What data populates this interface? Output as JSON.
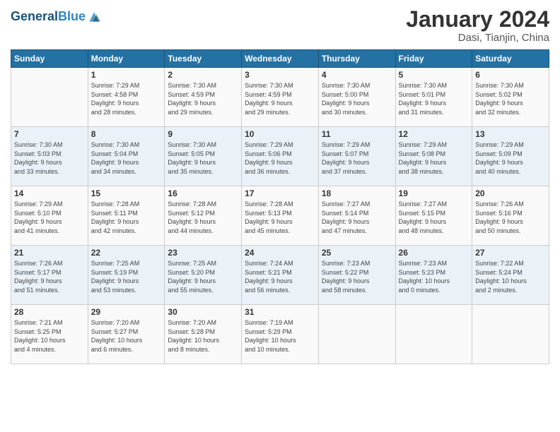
{
  "header": {
    "logo_line1": "General",
    "logo_line2": "Blue",
    "month": "January 2024",
    "location": "Dasi, Tianjin, China"
  },
  "columns": [
    "Sunday",
    "Monday",
    "Tuesday",
    "Wednesday",
    "Thursday",
    "Friday",
    "Saturday"
  ],
  "weeks": [
    [
      {
        "day": "",
        "info": ""
      },
      {
        "day": "1",
        "info": "Sunrise: 7:29 AM\nSunset: 4:58 PM\nDaylight: 9 hours\nand 28 minutes."
      },
      {
        "day": "2",
        "info": "Sunrise: 7:30 AM\nSunset: 4:59 PM\nDaylight: 9 hours\nand 29 minutes."
      },
      {
        "day": "3",
        "info": "Sunrise: 7:30 AM\nSunset: 4:59 PM\nDaylight: 9 hours\nand 29 minutes."
      },
      {
        "day": "4",
        "info": "Sunrise: 7:30 AM\nSunset: 5:00 PM\nDaylight: 9 hours\nand 30 minutes."
      },
      {
        "day": "5",
        "info": "Sunrise: 7:30 AM\nSunset: 5:01 PM\nDaylight: 9 hours\nand 31 minutes."
      },
      {
        "day": "6",
        "info": "Sunrise: 7:30 AM\nSunset: 5:02 PM\nDaylight: 9 hours\nand 32 minutes."
      }
    ],
    [
      {
        "day": "7",
        "info": "Sunrise: 7:30 AM\nSunset: 5:03 PM\nDaylight: 9 hours\nand 33 minutes."
      },
      {
        "day": "8",
        "info": "Sunrise: 7:30 AM\nSunset: 5:04 PM\nDaylight: 9 hours\nand 34 minutes."
      },
      {
        "day": "9",
        "info": "Sunrise: 7:30 AM\nSunset: 5:05 PM\nDaylight: 9 hours\nand 35 minutes."
      },
      {
        "day": "10",
        "info": "Sunrise: 7:29 AM\nSunset: 5:06 PM\nDaylight: 9 hours\nand 36 minutes."
      },
      {
        "day": "11",
        "info": "Sunrise: 7:29 AM\nSunset: 5:07 PM\nDaylight: 9 hours\nand 37 minutes."
      },
      {
        "day": "12",
        "info": "Sunrise: 7:29 AM\nSunset: 5:08 PM\nDaylight: 9 hours\nand 38 minutes."
      },
      {
        "day": "13",
        "info": "Sunrise: 7:29 AM\nSunset: 5:09 PM\nDaylight: 9 hours\nand 40 minutes."
      }
    ],
    [
      {
        "day": "14",
        "info": "Sunrise: 7:29 AM\nSunset: 5:10 PM\nDaylight: 9 hours\nand 41 minutes."
      },
      {
        "day": "15",
        "info": "Sunrise: 7:28 AM\nSunset: 5:11 PM\nDaylight: 9 hours\nand 42 minutes."
      },
      {
        "day": "16",
        "info": "Sunrise: 7:28 AM\nSunset: 5:12 PM\nDaylight: 9 hours\nand 44 minutes."
      },
      {
        "day": "17",
        "info": "Sunrise: 7:28 AM\nSunset: 5:13 PM\nDaylight: 9 hours\nand 45 minutes."
      },
      {
        "day": "18",
        "info": "Sunrise: 7:27 AM\nSunset: 5:14 PM\nDaylight: 9 hours\nand 47 minutes."
      },
      {
        "day": "19",
        "info": "Sunrise: 7:27 AM\nSunset: 5:15 PM\nDaylight: 9 hours\nand 48 minutes."
      },
      {
        "day": "20",
        "info": "Sunrise: 7:26 AM\nSunset: 5:16 PM\nDaylight: 9 hours\nand 50 minutes."
      }
    ],
    [
      {
        "day": "21",
        "info": "Sunrise: 7:26 AM\nSunset: 5:17 PM\nDaylight: 9 hours\nand 51 minutes."
      },
      {
        "day": "22",
        "info": "Sunrise: 7:25 AM\nSunset: 5:19 PM\nDaylight: 9 hours\nand 53 minutes."
      },
      {
        "day": "23",
        "info": "Sunrise: 7:25 AM\nSunset: 5:20 PM\nDaylight: 9 hours\nand 55 minutes."
      },
      {
        "day": "24",
        "info": "Sunrise: 7:24 AM\nSunset: 5:21 PM\nDaylight: 9 hours\nand 56 minutes."
      },
      {
        "day": "25",
        "info": "Sunrise: 7:23 AM\nSunset: 5:22 PM\nDaylight: 9 hours\nand 58 minutes."
      },
      {
        "day": "26",
        "info": "Sunrise: 7:23 AM\nSunset: 5:23 PM\nDaylight: 10 hours\nand 0 minutes."
      },
      {
        "day": "27",
        "info": "Sunrise: 7:22 AM\nSunset: 5:24 PM\nDaylight: 10 hours\nand 2 minutes."
      }
    ],
    [
      {
        "day": "28",
        "info": "Sunrise: 7:21 AM\nSunset: 5:25 PM\nDaylight: 10 hours\nand 4 minutes."
      },
      {
        "day": "29",
        "info": "Sunrise: 7:20 AM\nSunset: 5:27 PM\nDaylight: 10 hours\nand 6 minutes."
      },
      {
        "day": "30",
        "info": "Sunrise: 7:20 AM\nSunset: 5:28 PM\nDaylight: 10 hours\nand 8 minutes."
      },
      {
        "day": "31",
        "info": "Sunrise: 7:19 AM\nSunset: 5:29 PM\nDaylight: 10 hours\nand 10 minutes."
      },
      {
        "day": "",
        "info": ""
      },
      {
        "day": "",
        "info": ""
      },
      {
        "day": "",
        "info": ""
      }
    ]
  ]
}
